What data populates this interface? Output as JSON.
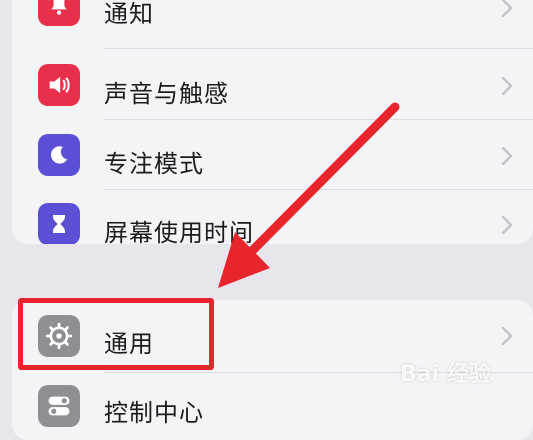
{
  "settings": {
    "group1": [
      {
        "label": "通知",
        "icon": "bell-icon",
        "color": "#e8304a"
      },
      {
        "label": "声音与触感",
        "icon": "speaker-icon",
        "color": "#e8304a"
      },
      {
        "label": "专注模式",
        "icon": "moon-icon",
        "color": "#5b4fd6"
      },
      {
        "label": "屏幕使用时间",
        "icon": "hourglass-icon",
        "color": "#5b4fd6"
      }
    ],
    "group2": [
      {
        "label": "通用",
        "icon": "gear-icon",
        "color": "#8e8e93"
      },
      {
        "label": "控制中心",
        "icon": "toggle-icon",
        "color": "#8e8e93"
      }
    ]
  },
  "annotation": {
    "color": "#e8242c",
    "highlighted_item": "通用"
  },
  "watermark": {
    "text": "Bai 经验"
  }
}
